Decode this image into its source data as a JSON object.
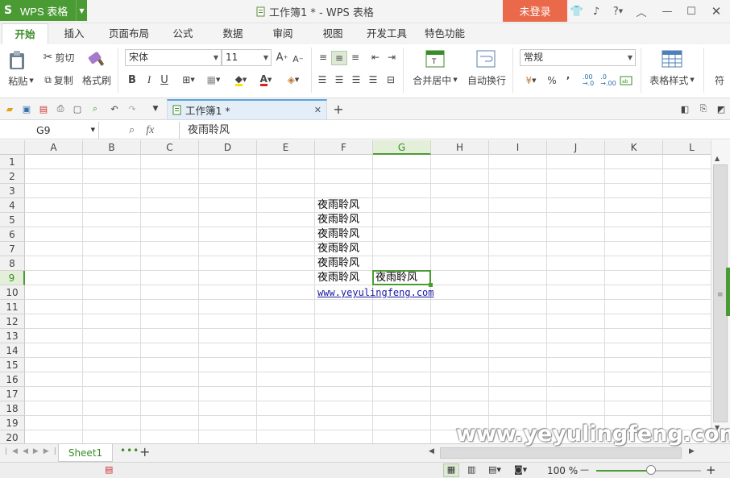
{
  "titlebar": {
    "app_name": "WPS 表格",
    "doc_title": "工作簿1 * - WPS 表格",
    "login": "未登录",
    "help": "?"
  },
  "tabs": [
    "开始",
    "插入",
    "页面布局",
    "公式",
    "数据",
    "审阅",
    "视图",
    "开发工具",
    "特色功能"
  ],
  "ribbon": {
    "paste": "粘贴",
    "cut": "剪切",
    "copy": "复制",
    "format_painter": "格式刷",
    "font_name": "宋体",
    "font_size": "11",
    "bold": "B",
    "italic": "I",
    "underline": "U",
    "merge_center": "合并居中",
    "wrap_text": "自动换行",
    "number_format": "常规",
    "percent": "%",
    "comma": "’",
    "inc_decimal": ".00\n→.0",
    "dec_decimal": ".0\n→.00",
    "table_style": "表格样式",
    "more": "符"
  },
  "doc_tab": {
    "label": "工作簿1 *"
  },
  "formula_bar": {
    "name_box": "G9",
    "fx": "fx",
    "value": "夜雨聆风"
  },
  "grid": {
    "columns": [
      "A",
      "B",
      "C",
      "D",
      "E",
      "F",
      "G",
      "H",
      "I",
      "J",
      "K",
      "L"
    ],
    "rows": [
      "1",
      "2",
      "3",
      "4",
      "5",
      "6",
      "7",
      "8",
      "9",
      "10",
      "11",
      "12",
      "13",
      "14",
      "15",
      "16",
      "17",
      "18",
      "19",
      "20"
    ],
    "selected_col": "G",
    "selected_row": "9",
    "cells": [
      {
        "ref": "F4",
        "value": "夜雨聆风"
      },
      {
        "ref": "F5",
        "value": "夜雨聆风"
      },
      {
        "ref": "F6",
        "value": "夜雨聆风"
      },
      {
        "ref": "F7",
        "value": "夜雨聆风"
      },
      {
        "ref": "F8",
        "value": "夜雨聆风"
      },
      {
        "ref": "F9",
        "value": "夜雨聆风"
      },
      {
        "ref": "G9",
        "value": "夜雨聆风"
      },
      {
        "ref": "F10",
        "value": "www.yeyulingfeng.com",
        "link": true
      }
    ]
  },
  "sheetbar": {
    "sheet_name": "Sheet1",
    "add": "+"
  },
  "statusbar": {
    "zoom": "100 %",
    "minus": "—",
    "plus": "+",
    "zoom_fraction": 0.52
  },
  "watermark": "www.yeyulingfeng.com",
  "colors": {
    "accent": "#4a9b34",
    "login": "#e9694a",
    "link": "#1a1aa6"
  }
}
